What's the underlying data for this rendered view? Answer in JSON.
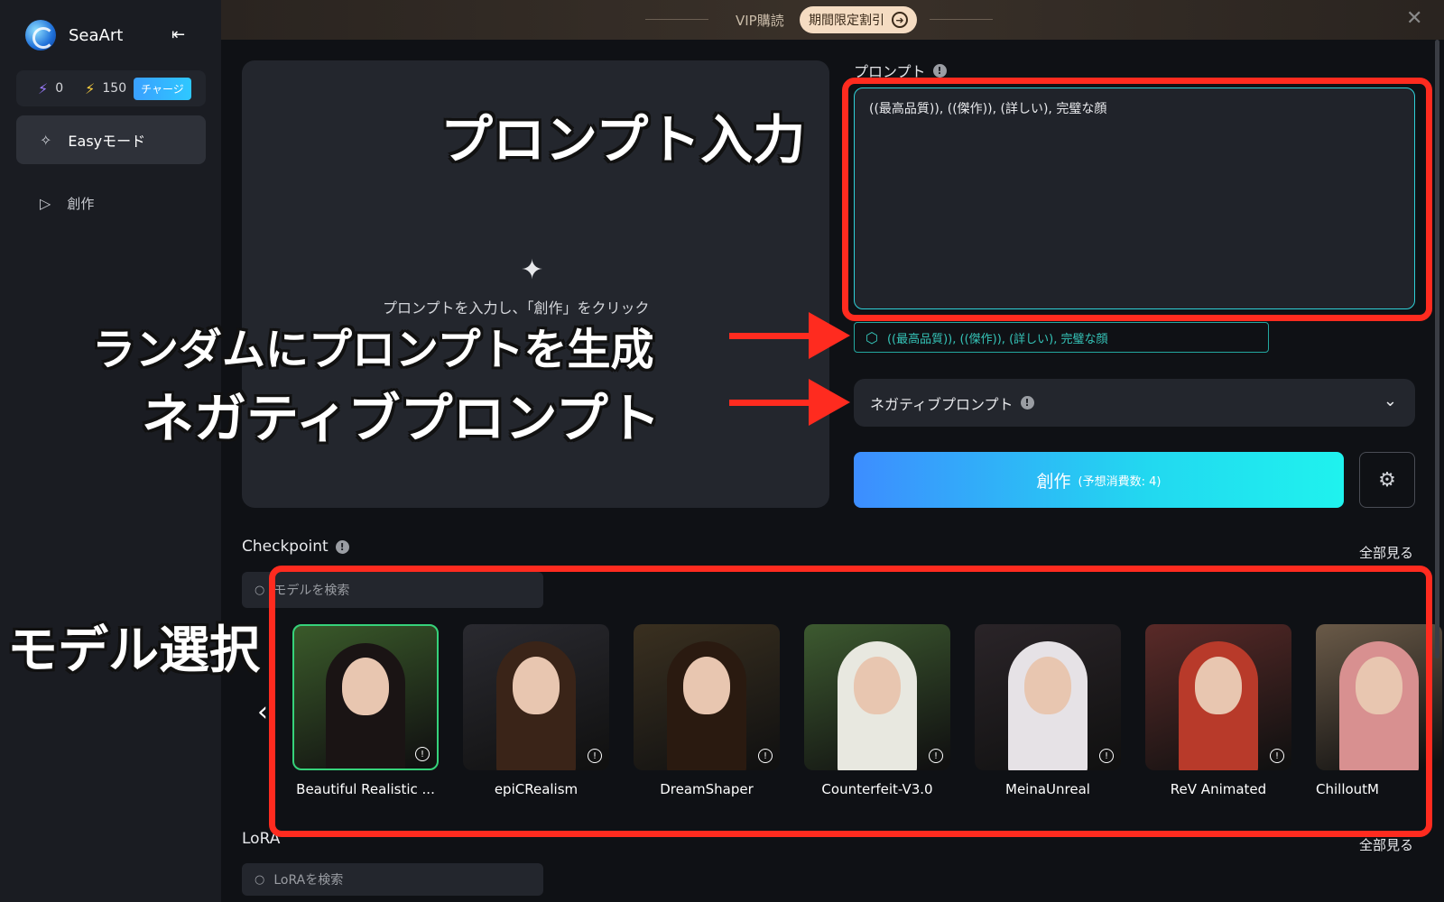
{
  "sidebar": {
    "app_name": "SeaArt",
    "credits_a": "0",
    "credits_b": "150",
    "charge_label": "チャージ",
    "easy_mode_label": "Easyモード",
    "create_label": "創作"
  },
  "topbar": {
    "vip_label": "VIP購読",
    "promo_label": "期間限定割引"
  },
  "preview": {
    "hint": "プロンプトを入力し、「創作」をクリック"
  },
  "prompt": {
    "label": "プロンプト",
    "value": "((最高品質)), ((傑作)), (詳しい), 完璧な顔",
    "random_suggestion": "((最高品質)), ((傑作)), (詳しい), 完璧な顔",
    "negative_label": "ネガティブプロンプト"
  },
  "create_button": {
    "label": "創作",
    "cost": "(予想消費数: 4)"
  },
  "checkpoint": {
    "label": "Checkpoint",
    "see_all": "全部見る",
    "search_placeholder": "モデルを検索",
    "models": [
      {
        "name": "Beautiful Realistic ...",
        "selected": true
      },
      {
        "name": "epiCRealism",
        "selected": false
      },
      {
        "name": "DreamShaper",
        "selected": false
      },
      {
        "name": "Counterfeit-V3.0",
        "selected": false
      },
      {
        "name": "MeinaUnreal",
        "selected": false
      },
      {
        "name": "ReV Animated",
        "selected": false
      },
      {
        "name": "ChilloutM",
        "selected": false
      }
    ]
  },
  "lora": {
    "label": "LoRA",
    "see_all": "全部見る",
    "search_placeholder": "LoRAを検索"
  },
  "annotations": {
    "prompt_input": "プロンプト入力",
    "random_prompt": "ランダムにプロンプトを生成",
    "negative_prompt": "ネガティブプロンプト",
    "model_select": "モデル選択"
  },
  "colors": {
    "accent_red": "#ff2b1f",
    "accent_cyan": "#2fd0d8",
    "selected_green": "#36d27a"
  }
}
